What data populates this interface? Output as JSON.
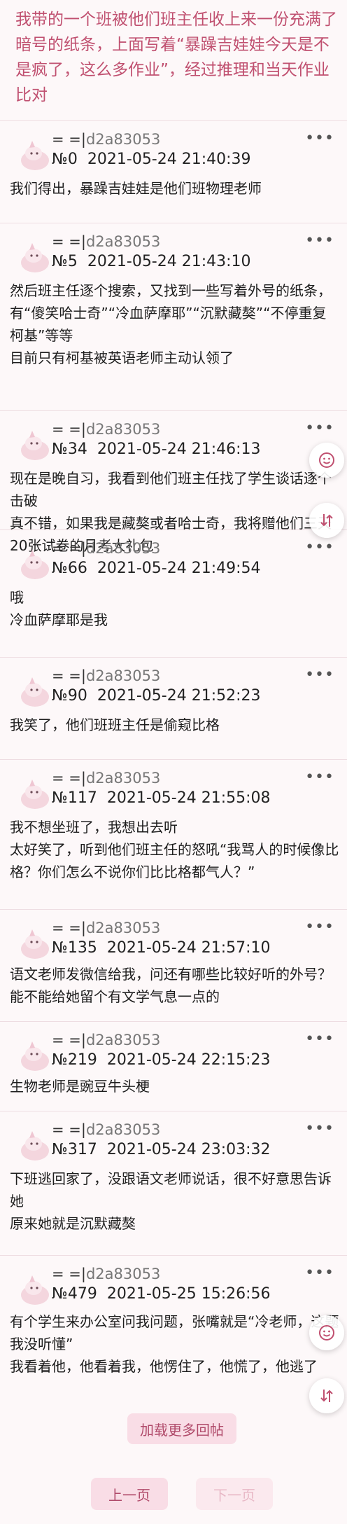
{
  "header": {
    "text": "我带的一个班被他们班主任收上来一份充满了暗号的纸条，上面写着“暴躁吉娃娃今天是不是疯了，这么多作业”，经过推理和当天作业比对"
  },
  "author": {
    "prefix": "= =|",
    "uid": "d2a83053"
  },
  "more_label": "•••",
  "posts": [
    {
      "floor": "№0",
      "time": "2021-05-24 21:40:39",
      "lines": [
        "我们得出，暴躁吉娃娃是他们班物理老师"
      ]
    },
    {
      "floor": "№5",
      "time": "2021-05-24 21:43:10",
      "lines": [
        "然后班主任逐个搜索，又找到一些写着外号的纸条，有“傻笑哈士奇”“冷血萨摩耶”“沉默藏獒”“不停重复柯基”等等",
        "目前只有柯基被英语老师主动认领了"
      ]
    },
    {
      "floor": "№34",
      "time": "2021-05-24 21:46:13",
      "lines": [
        "现在是晚自习，我看到他们班主任找了学生谈话逐个击破",
        "真不错，如果我是藏獒或者哈士奇，我将赠他们三天20张试卷的月考大礼包"
      ]
    },
    {
      "floor": "№66",
      "time": "2021-05-24 21:49:54",
      "lines": [
        "哦",
        "冷血萨摩耶是我"
      ]
    },
    {
      "floor": "№90",
      "time": "2021-05-24 21:52:23",
      "lines": [
        "我笑了，他们班班主任是偷窥比格"
      ]
    },
    {
      "floor": "№117",
      "time": "2021-05-24 21:55:08",
      "lines": [
        "我不想坐班了，我想出去听",
        "太好笑了，听到他们班主任的怒吼“我骂人的时候像比格？你们怎么不说你们比比格都气人？”"
      ]
    },
    {
      "floor": "№135",
      "time": "2021-05-24 21:57:10",
      "lines": [
        "语文老师发微信给我，问还有哪些比较好听的外号？能不能给她留个有文学气息一点的"
      ]
    },
    {
      "floor": "№219",
      "time": "2021-05-24 22:15:23",
      "lines": [
        "生物老师是豌豆牛头梗"
      ]
    },
    {
      "floor": "№317",
      "time": "2021-05-24 23:03:32",
      "lines": [
        "下班逃回家了，没跟语文老师说话，很不好意思告诉她",
        "原来她就是沉默藏獒"
      ]
    },
    {
      "floor": "№479",
      "time": "2021-05-25 15:26:56",
      "lines": [
        "有个学生来办公室问我问题，张嘴就是“冷老师，这题我没听懂”",
        "我看着他，他看着我，他愣住了，他慌了，他逃了"
      ]
    }
  ],
  "load_more": "加载更多回帖",
  "pager": {
    "prev": "上一页",
    "next": "下一页"
  },
  "colors": {
    "accent": "#c05070",
    "button_bg": "#f9dde6"
  }
}
